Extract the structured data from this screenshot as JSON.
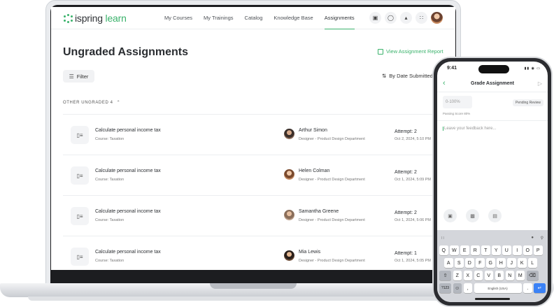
{
  "nav": {
    "logo_prefix": "ispring",
    "logo_suffix": "learn",
    "links": [
      "My Courses",
      "My Trainings",
      "Catalog",
      "Knowledge Base",
      "Assignments"
    ],
    "active_link": "Assignments",
    "icons": [
      "gift-icon",
      "chat-icon",
      "bell-icon",
      "grid-icon"
    ]
  },
  "page": {
    "title": "Ungraded Assignments",
    "report_link": "View Assignment Report",
    "filter_label": "Filter",
    "sort_label": "By Date Submitted",
    "section_label": "OTHER UNGRADED 4"
  },
  "rows": [
    {
      "title": "Calculate personal income tax",
      "course": "Course: Taxation",
      "name": "Arthur Simon",
      "role": "Designer - Product Design Department",
      "attempt": "Attempt: 2",
      "date": "Oct 2, 2024, 5:10 PM"
    },
    {
      "title": "Calculate personal income tax",
      "course": "Course: Taxation",
      "name": "Helen Colman",
      "role": "Designer - Product Design Department",
      "attempt": "Attempt: 2",
      "date": "Oct 1, 2024, 5:09 PM"
    },
    {
      "title": "Calculate personal income tax",
      "course": "Course: Taxation",
      "name": "Samantha Greene",
      "role": "Designer - Product Design Department",
      "attempt": "Attempt: 2",
      "date": "Oct 1, 2024, 5:06 PM"
    },
    {
      "title": "Calculate personal income tax",
      "course": "Course: Taxation",
      "name": "Mia Lewis",
      "role": "Designer - Product Design Department",
      "attempt": "Attempt: 1",
      "date": "Oct 1, 2024, 5:05 PM"
    }
  ],
  "phone": {
    "time": "9:41",
    "title": "Grade Assignment",
    "score_placeholder": "0-100%",
    "status_badge": "Pending Review",
    "passing_score": "Passing Score 80%",
    "feedback_placeholder": "Leave your feedback here...",
    "keyboard": {
      "row1": [
        "Q",
        "W",
        "E",
        "R",
        "T",
        "Y",
        "U",
        "I",
        "O",
        "P"
      ],
      "row2": [
        "A",
        "S",
        "D",
        "F",
        "G",
        "H",
        "J",
        "K",
        "L"
      ],
      "row3": [
        "Z",
        "X",
        "C",
        "V",
        "B",
        "N",
        "M"
      ],
      "num_key": "?123",
      "space_label": "English (USA)"
    }
  },
  "colors": {
    "accent": "#3ab26b",
    "text": "#2a2d31",
    "muted": "#777777"
  }
}
